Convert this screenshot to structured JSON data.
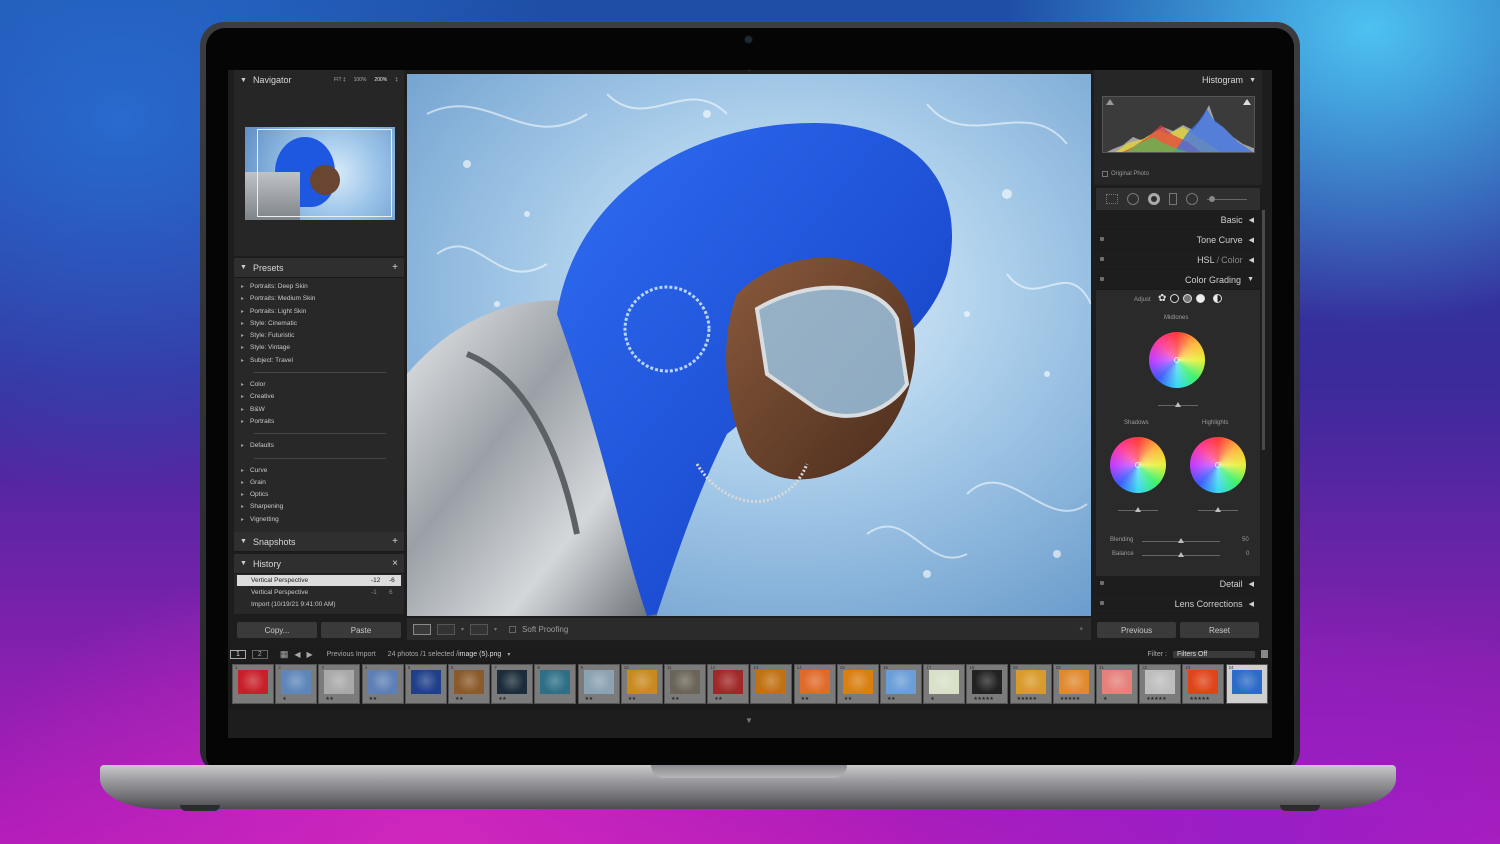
{
  "navigator": {
    "title": "Navigator",
    "zoom_options": [
      "FIT ‡",
      "100%",
      "200%",
      "‡"
    ]
  },
  "presets": {
    "title": "Presets",
    "add_icon": "+",
    "groups": [
      [
        "Portraits: Deep Skin",
        "Portraits: Medium Skin",
        "Portraits: Light Skin",
        "Style: Cinematic",
        "Style: Futuristic",
        "Style: Vintage",
        "Subject: Travel"
      ],
      [
        "Color",
        "Creative",
        "B&W",
        "Portraits"
      ],
      [
        "Defaults"
      ],
      [
        "Curve",
        "Grain",
        "Optics",
        "Sharpening",
        "Vignetting"
      ]
    ]
  },
  "snapshots": {
    "title": "Snapshots",
    "add_icon": "+"
  },
  "history": {
    "title": "History",
    "close_icon": "×",
    "items": [
      {
        "label": "Vertical Perspective",
        "a": "-12",
        "b": "-6"
      },
      {
        "label": "Vertical Perspective",
        "a": "-1",
        "b": "6"
      },
      {
        "label": "Import (10/19/21 9:41:00 AM)",
        "a": "",
        "b": ""
      }
    ]
  },
  "left_buttons": {
    "copy": "Copy...",
    "paste": "Paste"
  },
  "toolbar": {
    "soft_proofing": "Soft Proofing"
  },
  "histogram": {
    "title": "Histogram",
    "original_photo": "Original Photo"
  },
  "right_sections": {
    "basic": "Basic",
    "tone_curve": "Tone Curve",
    "hsl": "HSL",
    "color": "Color",
    "color_grading": "Color Grading",
    "detail": "Detail",
    "lens_corrections": "Lens Corrections"
  },
  "color_grading": {
    "adjust": "Adjust",
    "midtones": "Midtones",
    "shadows": "Shadows",
    "highlights": "Highlights",
    "blending_label": "Blending",
    "blending_value": "50",
    "blending_level": 0.5,
    "balance_label": "Balance",
    "balance_value": "0",
    "balance_level": 0.5
  },
  "right_buttons": {
    "previous": "Previous",
    "reset": "Reset"
  },
  "filmstrip_bar": {
    "screen1": "1",
    "screen2": "2",
    "source": "Previous Import",
    "count_text": "24 photos /1 selected /",
    "filename": "image (5).png",
    "filter_label": "Filter :",
    "filter_value": "Filters Off"
  },
  "filmstrip": [
    {
      "n": "1",
      "stars": "",
      "color": "#c8202a"
    },
    {
      "n": "2",
      "stars": "★",
      "color": "#5d86b9"
    },
    {
      "n": "3",
      "stars": "★★",
      "color": "#a9a9a9"
    },
    {
      "n": "4",
      "stars": "★★",
      "color": "#5d7fb5"
    },
    {
      "n": "5",
      "stars": "",
      "color": "#1f3f8a"
    },
    {
      "n": "6",
      "stars": "★★",
      "color": "#8a5a2a"
    },
    {
      "n": "7",
      "stars": "★★",
      "color": "#1c2c3a"
    },
    {
      "n": "8",
      "stars": "",
      "color": "#2e6f86"
    },
    {
      "n": "9",
      "stars": "★★",
      "color": "#8aa2b1"
    },
    {
      "n": "10",
      "stars": "★★",
      "color": "#c88a1f"
    },
    {
      "n": "11",
      "stars": "★★",
      "color": "#6b6558"
    },
    {
      "n": "12",
      "stars": "★★",
      "color": "#a02828"
    },
    {
      "n": "13",
      "stars": "",
      "color": "#c07212"
    },
    {
      "n": "14",
      "stars": "★★",
      "color": "#e06a2a"
    },
    {
      "n": "15",
      "stars": "★★",
      "color": "#d87f0f"
    },
    {
      "n": "16",
      "stars": "★★",
      "color": "#6a9ed8"
    },
    {
      "n": "17",
      "stars": "★",
      "color": "#d8e0c8"
    },
    {
      "n": "18",
      "stars": "★★★★★",
      "color": "#222222"
    },
    {
      "n": "19",
      "stars": "★★★★★",
      "color": "#d89a2a"
    },
    {
      "n": "20",
      "stars": "★★★★★",
      "color": "#e08a30"
    },
    {
      "n": "21",
      "stars": "★",
      "color": "#e6807a"
    },
    {
      "n": "22",
      "stars": "★★★★★",
      "color": "#bdbdbd"
    },
    {
      "n": "23",
      "stars": "★★★★★",
      "color": "#e0441a"
    },
    {
      "n": "24",
      "stars": "",
      "color": "#2c6bc8"
    }
  ],
  "colors": {
    "accent_blue": "#1f58e0",
    "panel": "#282828"
  }
}
